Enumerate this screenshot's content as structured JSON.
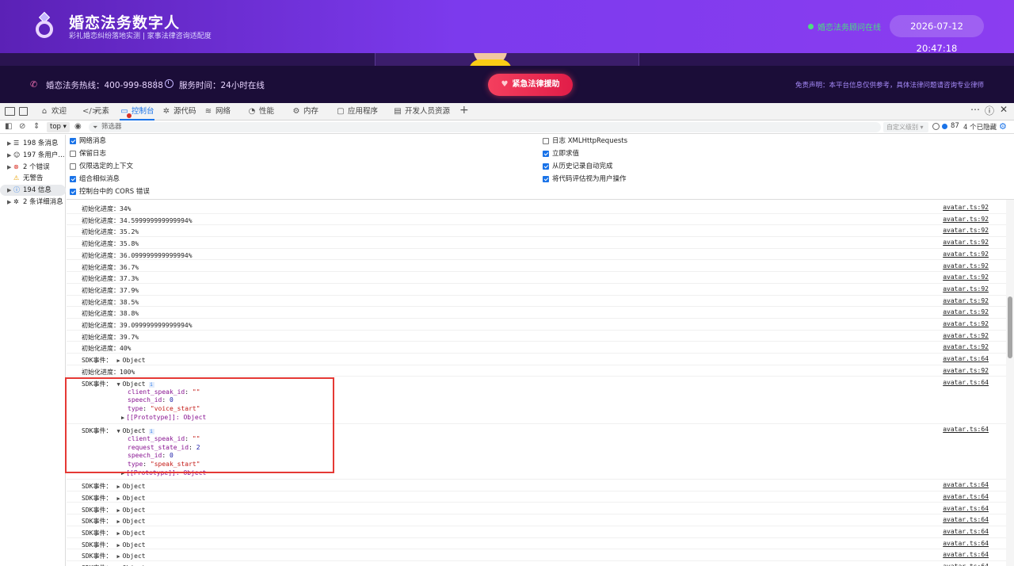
{
  "app": {
    "title": "婚恋法务数字人",
    "subtitle": "彩礼婚恋纠纷落地实测 | 家事法律咨询适配度",
    "online_status": "婚恋法务顾问在线",
    "datetime": "2026-07-12 20:47:18",
    "hotline": "婚恋法务热线：400-999-8888",
    "service_hours": "服务时间：24小时在线",
    "emergency_button": "紧急法律援助",
    "disclaimer": "免责声明：本平台信息仅供参考，具体法律问题请咨询专业律师",
    "colors": {
      "brand": "#7c3aed",
      "online": "#4ade80",
      "emergency": "#e11d48"
    }
  },
  "devtools": {
    "tabs": [
      {
        "label": "欢迎",
        "icon": "house-icon"
      },
      {
        "label": "元素",
        "icon": "code-icon"
      },
      {
        "label": "控制台",
        "icon": "console-icon"
      },
      {
        "label": "源代码",
        "icon": "bug-icon"
      },
      {
        "label": "网络",
        "icon": "wifi-icon"
      },
      {
        "label": "性能",
        "icon": "performance-icon"
      },
      {
        "label": "内存",
        "icon": "memory-icon"
      },
      {
        "label": "应用程序",
        "icon": "application-icon"
      },
      {
        "label": "开发人员资源",
        "icon": "document-icon"
      }
    ],
    "active_tab": "控制台",
    "toolbar": {
      "context": "top",
      "filter_placeholder": "筛选器",
      "level": "自定义级别",
      "issues_count": "87",
      "hidden": "4 个已隐藏"
    },
    "sidebar": [
      {
        "label": "198 条消息",
        "icon": "list-icon"
      },
      {
        "label": "197 条用户...",
        "icon": "user-icon"
      },
      {
        "label": "2 个错误",
        "icon": "error-icon"
      },
      {
        "label": "无警告",
        "icon": "warning-icon"
      },
      {
        "label": "194 信息",
        "icon": "info-icon"
      },
      {
        "label": "2 条详细消息",
        "icon": "verbose-icon"
      }
    ],
    "settings_left": [
      {
        "label": "网络消息",
        "checked": true
      },
      {
        "label": "保留日志",
        "checked": false
      },
      {
        "label": "仅限选定的上下文",
        "checked": false
      },
      {
        "label": "组合相似消息",
        "checked": true
      },
      {
        "label": "控制台中的 CORS 错误",
        "checked": true
      }
    ],
    "settings_right": [
      {
        "label": "日志 XMLHttpRequests",
        "checked": false
      },
      {
        "label": "立即求值",
        "checked": true
      },
      {
        "label": "从历史记录自动完成",
        "checked": true
      },
      {
        "label": "将代码评估视为用户操作",
        "checked": true
      }
    ],
    "console": {
      "progress_label": "初始化进度：",
      "sdk_label": "SDK事件：",
      "object_label": "Object",
      "proto_label": "[[Prototype]]: Object",
      "src_progress": "avatar.ts:92",
      "src_sdk": "avatar.ts:64",
      "progress_values": [
        "34%",
        "34.599999999999994%",
        "35.2%",
        "35.8%",
        "36.099999999999994%",
        "36.7%",
        "37.3%",
        "37.9%",
        "38.5%",
        "38.8%",
        "39.099999999999994%",
        "39.7%",
        "40%"
      ],
      "final_progress": "100%",
      "expanded_events": [
        {
          "props": [
            {
              "key": "client_speak_id",
              "value": "\"\"",
              "kind": "string"
            },
            {
              "key": "speech_id",
              "value": "0",
              "kind": "number"
            },
            {
              "key": "type",
              "value": "\"voice_start\"",
              "kind": "string"
            }
          ]
        },
        {
          "props": [
            {
              "key": "client_speak_id",
              "value": "\"\"",
              "kind": "string"
            },
            {
              "key": "request_state_id",
              "value": "2",
              "kind": "number"
            },
            {
              "key": "speech_id",
              "value": "0",
              "kind": "number"
            },
            {
              "key": "type",
              "value": "\"speak_start\"",
              "kind": "string"
            }
          ]
        }
      ],
      "collapsed_sdk_count_after": 8
    }
  }
}
